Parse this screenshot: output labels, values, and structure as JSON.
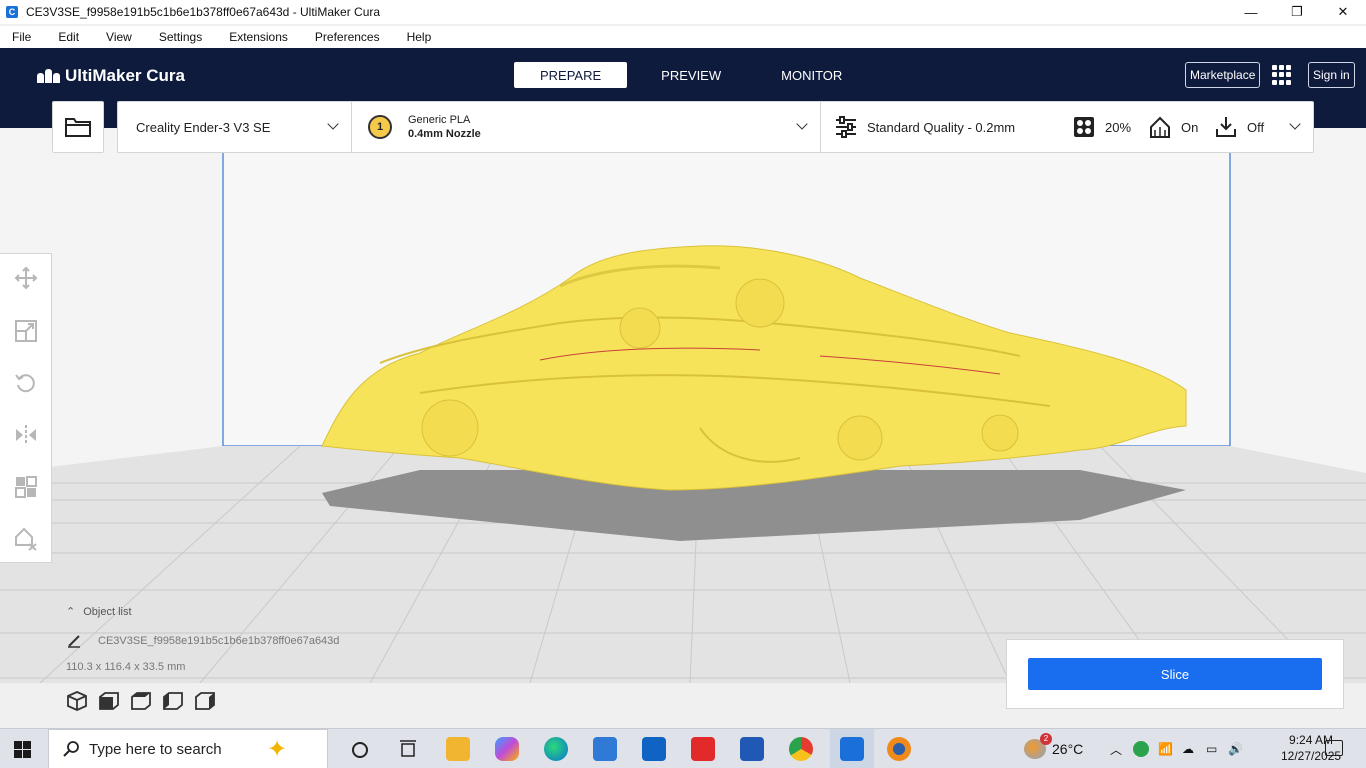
{
  "window": {
    "title": "CE3V3SE_f9958e191b5c1b6e1b378ff0e67a643d - UltiMaker Cura",
    "app_icon_letter": "C",
    "minimize": "—",
    "restore": "❐",
    "close": "✕"
  },
  "menu": [
    "File",
    "Edit",
    "View",
    "Settings",
    "Extensions",
    "Preferences",
    "Help"
  ],
  "header": {
    "logo": "UltiMaker Cura",
    "tabs": [
      "PREPARE",
      "PREVIEW",
      "MONITOR"
    ],
    "active_tab": "PREPARE",
    "marketplace": "Marketplace",
    "sign_in": "Sign in"
  },
  "toolbar": {
    "printer": "Creality Ender-3 V3 SE",
    "material_slot": "1",
    "material_name": "Generic PLA",
    "nozzle": "0.4mm Nozzle",
    "quality": "Standard Quality - 0.2mm",
    "infill": "20%",
    "support": "On",
    "adhesion": "Off"
  },
  "tools": [
    "move-tool-icon",
    "scale-tool-icon",
    "rotate-tool-icon",
    "mirror-tool-icon",
    "per-model-settings-icon",
    "support-blocker-icon"
  ],
  "object_list": {
    "header": "Object list",
    "object_name": "CE3V3SE_f9958e191b5c1b6e1b378ff0e67a643d",
    "dimensions": "110.3 x 116.4 x 33.5 mm"
  },
  "view_buttons": [
    "3d-view-icon",
    "front-view-icon",
    "top-view-icon",
    "left-view-icon",
    "right-view-icon"
  ],
  "slice": {
    "label": "Slice"
  },
  "taskbar": {
    "search_placeholder": "Type here to search",
    "weather": "26°C",
    "weather_badge": "2",
    "time": "9:24 AM",
    "date": "12/27/2025"
  },
  "colors": {
    "header_bg": "#0f1b3d",
    "accent": "#196ef0",
    "model": "#f7e35a"
  }
}
